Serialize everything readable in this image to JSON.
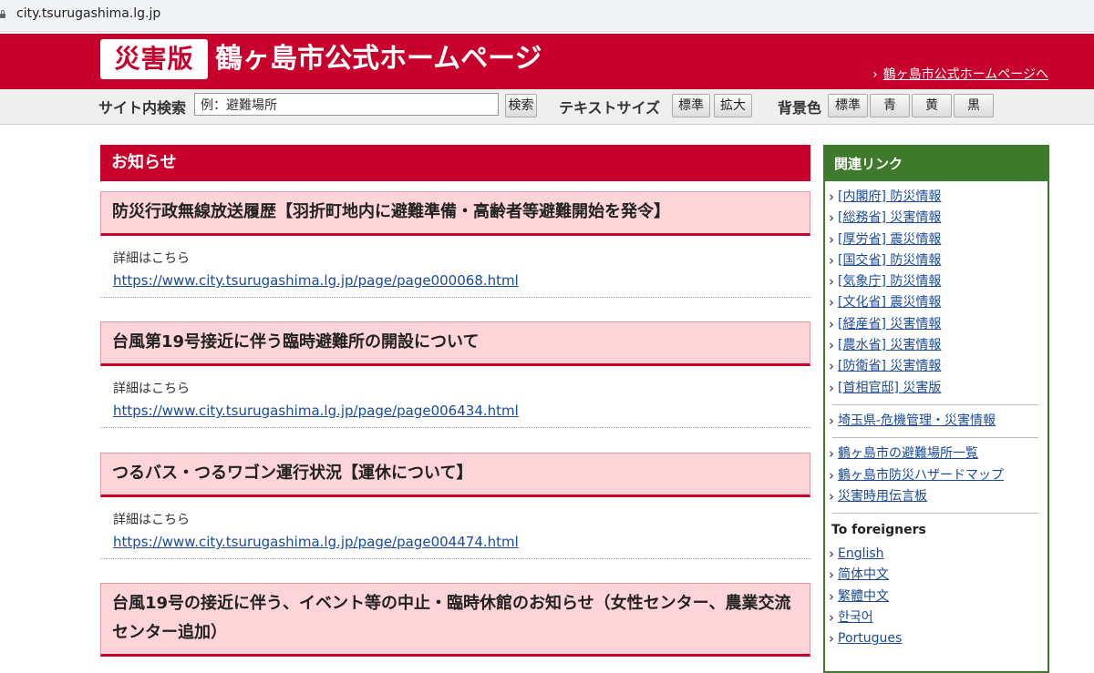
{
  "browser": {
    "url": "city.tsurugashima.lg.jp"
  },
  "header": {
    "badge": "災害版",
    "title": "鶴ヶ島市公式ホームページ",
    "home_link": "鶴ヶ島市公式ホームページへ",
    "bg_color": "#c8002c"
  },
  "toolbar": {
    "search_label": "サイト内検索",
    "search_placeholder": "例：避難場所",
    "search_button": "検索",
    "text_size_label": "テキストサイズ",
    "text_size_standard": "標準",
    "text_size_large": "拡大",
    "bg_label": "背景色",
    "bg_standard": "標準",
    "bg_blue": "青",
    "bg_yellow": "黄",
    "bg_black": "黒"
  },
  "main": {
    "section_title": "お知らせ",
    "items": [
      {
        "title": "防災行政無線放送履歴【羽折町地内に避難準備・高齢者等避難開始を発令】",
        "detail": "詳細はこちら",
        "url": "https://www.city.tsurugashima.lg.jp/page/page000068.html"
      },
      {
        "title": "台風第19号接近に伴う臨時避難所の開設について",
        "detail": "詳細はこちら",
        "url": "https://www.city.tsurugashima.lg.jp/page/page006434.html"
      },
      {
        "title": "つるバス・つるワゴン運行状況【運休について】",
        "detail": "詳細はこちら",
        "url": "https://www.city.tsurugashima.lg.jp/page/page004474.html"
      },
      {
        "title": "台風19号の接近に伴う、イベント等の中止・臨時休館のお知らせ（女性センター、農業交流センター追加）"
      }
    ]
  },
  "sidebar": {
    "title": "関連リンク",
    "links_gov": [
      "[内閣府] 防災情報",
      "[総務省] 災害情報",
      "[厚労省] 震災情報",
      "[国交省] 防災情報",
      "[気象庁] 防災情報",
      "[文化省] 震災情報",
      "[経産省] 災害情報",
      "[農水省] 災害情報",
      "[防衛省] 災害情報",
      "[首相官邸] 災害版"
    ],
    "links_pref": [
      "埼玉県-危機管理・災害情報"
    ],
    "links_city": [
      "鶴ヶ島市の避難場所一覧",
      "鶴ヶ島市防災ハザードマップ",
      "災害時用伝言板"
    ],
    "foreigners_title": "To foreigners",
    "links_foreign": [
      "English",
      "简体中文",
      "繁體中文",
      "한국어",
      "Portugues"
    ],
    "accent": "#3d7a2b"
  }
}
